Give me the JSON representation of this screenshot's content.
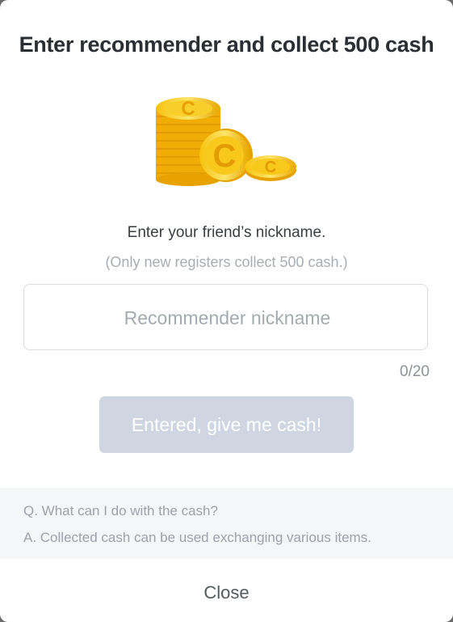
{
  "dialog": {
    "title": "Enter recommender and collect 500 cash",
    "coin_icon": "coin-stack-icon",
    "subtitle": "Enter your friend’s nickname.",
    "note": "(Only new registers collect 500 cash.)",
    "input": {
      "placeholder": "Recommender nickname",
      "value": ""
    },
    "counter": "0/20",
    "submit_label": "Entered, give me cash!",
    "faq": {
      "question": "Q. What can I do with the cash?",
      "answer": "A. Collected cash can be used exchanging various items."
    },
    "close_label": "Close"
  },
  "colors": {
    "title": "#2b2e33",
    "button_disabled": "#cfd6e2",
    "faq_bg": "#f4f6f8",
    "coin_gold": "#f5b90a"
  }
}
